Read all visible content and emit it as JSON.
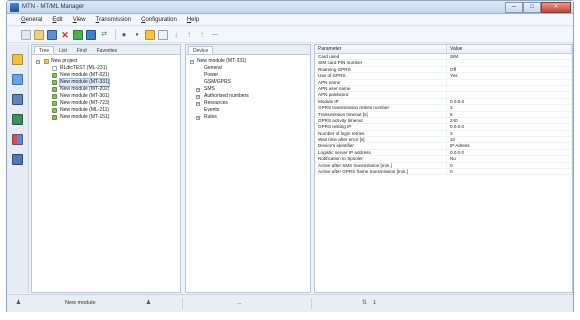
{
  "window": {
    "title": "MTN - MT/ML Manager",
    "minimize": "─",
    "maximize": "□",
    "close": "✕"
  },
  "menu": [
    {
      "label": "General",
      "u": "G",
      "rest": "eneral"
    },
    {
      "label": "Edit",
      "u": "E",
      "rest": "dit"
    },
    {
      "label": "View",
      "u": "V",
      "rest": "iew"
    },
    {
      "label": "Transmission",
      "u": "T",
      "rest": "ransmission"
    },
    {
      "label": "Configuration",
      "u": "C",
      "rest": "onfiguration"
    },
    {
      "label": "Help",
      "u": "H",
      "rest": "elp"
    }
  ],
  "toolbar": {
    "icons": [
      "new-icon",
      "open-icon",
      "save-icon",
      "delete-icon",
      "config-icon",
      "send-icon",
      "receive-icon",
      "user-icon",
      "dropdown-icon",
      "module-icon",
      "split-icon",
      "down-icon",
      "up-icon",
      "up-alt-icon",
      "minus-icon"
    ]
  },
  "left_panel": {
    "tabs": [
      "Tree",
      "List",
      "Find",
      "Favorites"
    ],
    "tree": {
      "root": "New project",
      "items": [
        "RLdicTEST (ML-231)",
        "New module (MT-021)",
        "New module (MT-331)",
        "New module (MT-202)",
        "New module (MT-301)",
        "New module (MT-723)",
        "New module (ML-211)",
        "New module (MT-151)"
      ]
    }
  },
  "mid_panel": {
    "tabs": [
      "Device"
    ],
    "tree": {
      "root": "New module (MT-331)",
      "items": [
        {
          "label": "General",
          "expandable": false
        },
        {
          "label": "Power",
          "expandable": false
        },
        {
          "label": "GSM/GPRS",
          "expandable": false
        },
        {
          "label": "SMS",
          "expandable": true
        },
        {
          "label": "Authorised numbers",
          "expandable": true
        },
        {
          "label": "Resources",
          "expandable": true
        },
        {
          "label": "Events",
          "expandable": false
        },
        {
          "label": "Rules",
          "expandable": true
        }
      ]
    }
  },
  "right_panel": {
    "headers": {
      "param": "Parameter",
      "value": "Value"
    },
    "rows": [
      {
        "param": "Card used",
        "value": "SIM"
      },
      {
        "param": "SIM card PIN number",
        "value": ""
      },
      {
        "param": "Roaming GPRS",
        "value": "Off"
      },
      {
        "param": "Use of GPRS",
        "value": "Yes"
      },
      {
        "param": "APN name",
        "value": ""
      },
      {
        "param": "APN user name",
        "value": ""
      },
      {
        "param": "APN password",
        "value": ""
      },
      {
        "param": "Module IP",
        "value": "0.0.0.0"
      },
      {
        "param": "GPRS transmission retries number",
        "value": "3"
      },
      {
        "param": "Transmission timeout [s]",
        "value": "5"
      },
      {
        "param": "GPRS activity timeout",
        "value": "240"
      },
      {
        "param": "GPRS testing IP",
        "value": "0.0.0.0"
      },
      {
        "param": "Number of login retries",
        "value": "3"
      },
      {
        "param": "Wait time after error [s]",
        "value": "10"
      },
      {
        "param": "Device's identifier",
        "value": "IP Adress"
      },
      {
        "param": "Logistic server IP address",
        "value": "0.0.0.0"
      },
      {
        "param": "Notification to Spooler",
        "value": "No"
      },
      {
        "param": "Active after SMS transmission [min.]",
        "value": "0"
      },
      {
        "param": "Active after GPRS frame transmission [min.]",
        "value": "0"
      }
    ]
  },
  "statusbar": {
    "module": "New module",
    "dots": "...",
    "page": "1"
  },
  "colors": {
    "accent": "#2b5ca8",
    "selection": "#dbe8f7",
    "border": "#b9c6d8"
  }
}
